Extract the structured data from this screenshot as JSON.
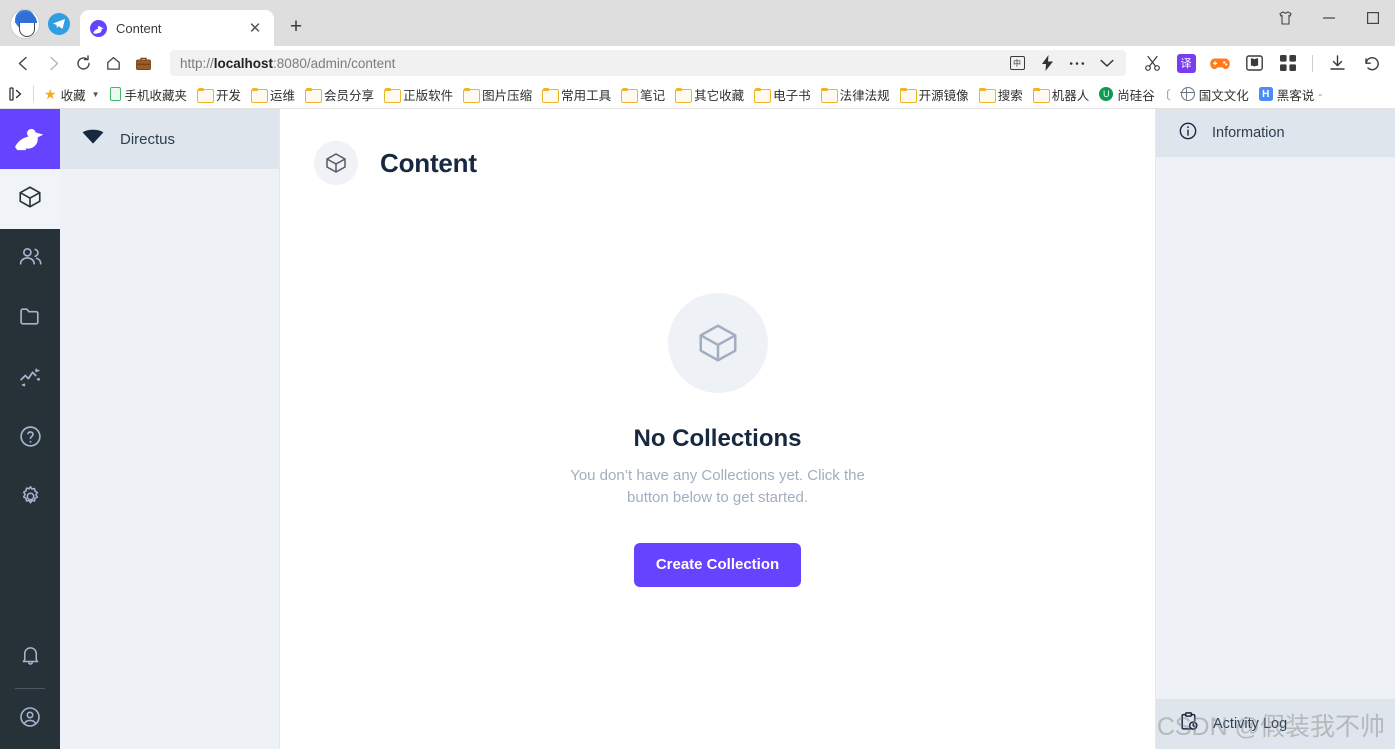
{
  "browser": {
    "window_controls": [
      {
        "name": "theme-skin-button",
        "glyph": "tshirt"
      },
      {
        "name": "minimize-button",
        "glyph": "minimize"
      },
      {
        "name": "maximize-button",
        "glyph": "maximize"
      }
    ],
    "tabs": [
      {
        "title": "Content",
        "favicon": "directus-rabbit-icon",
        "active": true
      }
    ],
    "new_tab_label": "+",
    "nav": {
      "back": "back-arrow-icon",
      "forward": "forward-arrow-icon",
      "reload": "reload-icon",
      "home": "home-icon",
      "collections": "briefcase-icon"
    },
    "url": {
      "scheme": "http://",
      "host": "localhost",
      "rest": ":8080/admin/content",
      "full": "http://localhost:8080/admin/content"
    },
    "url_actions": [
      {
        "name": "translate-icon",
        "label": "中"
      },
      {
        "name": "lightning-icon",
        "label": "⚡"
      },
      {
        "name": "more-options-icon",
        "label": "···"
      },
      {
        "name": "chevron-down-icon",
        "label": "⌄"
      }
    ],
    "toolbar_icons": [
      {
        "name": "screenshot-scissors-icon",
        "label": "✂"
      },
      {
        "name": "translate-badge-icon",
        "label": "译",
        "color": "#7a3cf0"
      },
      {
        "name": "game-controller-icon",
        "label": "",
        "color": "#ff7a1a"
      },
      {
        "name": "reading-mode-icon",
        "label": ""
      },
      {
        "name": "extensions-grid-icon",
        "label": ""
      },
      {
        "name": "downloads-icon",
        "label": "↓"
      },
      {
        "name": "history-back-icon",
        "label": "↺"
      }
    ],
    "bookmarks": [
      {
        "label": "收藏",
        "icon": "star-icon",
        "has_caret": true
      },
      {
        "label": "手机收藏夹",
        "icon": "phone-icon"
      },
      {
        "label": "开发",
        "icon": "folder-icon"
      },
      {
        "label": "运维",
        "icon": "folder-icon"
      },
      {
        "label": "会员分享",
        "icon": "folder-icon"
      },
      {
        "label": "正版软件",
        "icon": "folder-icon"
      },
      {
        "label": "图片压缩",
        "icon": "folder-icon"
      },
      {
        "label": "常用工具",
        "icon": "folder-icon"
      },
      {
        "label": "笔记",
        "icon": "folder-icon"
      },
      {
        "label": "其它收藏",
        "icon": "folder-icon"
      },
      {
        "label": "电子书",
        "icon": "folder-icon"
      },
      {
        "label": "法律法规",
        "icon": "folder-icon"
      },
      {
        "label": "开源镜像",
        "icon": "folder-icon"
      },
      {
        "label": "搜索",
        "icon": "folder-icon"
      },
      {
        "label": "机器人",
        "icon": "folder-icon"
      },
      {
        "label": "尚硅谷",
        "icon": "u-circle-icon",
        "trailing": "〔"
      },
      {
        "label": "国文文化",
        "icon": "globe-icon"
      },
      {
        "label": "黑客说",
        "icon": "h-square-icon",
        "trailing": "-"
      }
    ]
  },
  "app": {
    "module_bar": {
      "logo": "directus-rabbit-logo",
      "logo_color": "#6644ff",
      "items": [
        {
          "name": "module-content",
          "icon": "box-icon",
          "active": true
        },
        {
          "name": "module-users",
          "icon": "users-icon",
          "active": false
        },
        {
          "name": "module-files",
          "icon": "folder-icon",
          "active": false
        },
        {
          "name": "module-insights",
          "icon": "insights-chart-icon",
          "active": false
        },
        {
          "name": "module-docs",
          "icon": "help-circle-icon",
          "active": false
        },
        {
          "name": "module-settings",
          "icon": "gear-icon",
          "active": false
        }
      ],
      "bottom_items": [
        {
          "name": "notifications",
          "icon": "bell-icon"
        },
        {
          "name": "user-menu",
          "icon": "account-circle-icon"
        }
      ]
    },
    "nav_sidebar": {
      "project_name": "Directus",
      "project_icon": "directus-diamond-icon"
    },
    "content": {
      "page_icon": "box-icon",
      "page_title": "Content",
      "empty_state": {
        "icon": "box-icon",
        "title": "No Collections",
        "description": "You don’t have any Collections yet. Click the button below to get started.",
        "button_label": "Create Collection",
        "button_color": "#6644ff"
      }
    },
    "right_sidebar": {
      "info_icon": "info-circle-icon",
      "info_title": "Information",
      "activity_icon": "activity-clipboard-icon",
      "activity_title": "Activity Log"
    }
  },
  "watermark": "CSDN @假装我不帅"
}
